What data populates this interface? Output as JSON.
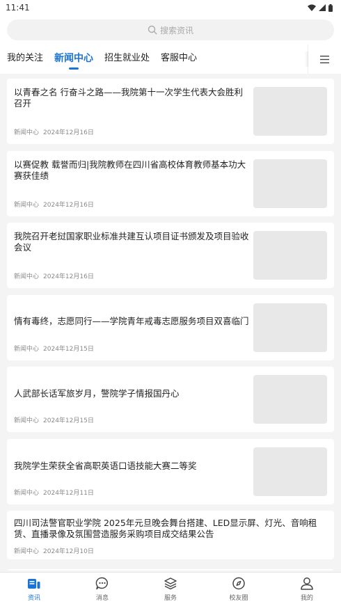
{
  "status": {
    "time": "11:41"
  },
  "search": {
    "placeholder": "搜索资讯"
  },
  "tabs": [
    {
      "label": "我的关注"
    },
    {
      "label": "新闻中心",
      "active": true
    },
    {
      "label": "招生就业处"
    },
    {
      "label": "客服中心"
    }
  ],
  "articles": [
    {
      "title": "以青春之名  行奋斗之路——我院第十一次学生代表大会胜利召开",
      "source": "新闻中心",
      "date": "2024年12月16日",
      "has_thumb": true
    },
    {
      "title": "以赛促教 载誉而归|我院教师在四川省高校体育教师基本功大赛获佳绩",
      "source": "新闻中心",
      "date": "2024年12月16日",
      "has_thumb": true
    },
    {
      "title": "我院召开老挝国家职业标准共建互认项目证书颁发及项目验收会议",
      "source": "新闻中心",
      "date": "2024年12月16日",
      "has_thumb": true
    },
    {
      "title": "情有毒终，志愿同行——学院青年戒毒志愿服务项目双喜临门",
      "source": "新闻中心",
      "date": "2024年12月15日",
      "has_thumb": true
    },
    {
      "title": "人武部长话军旅岁月，警院学子情报国丹心",
      "source": "新闻中心",
      "date": "2024年12月15日",
      "has_thumb": true
    },
    {
      "title": "我院学生荣获全省高职英语口语技能大赛二等奖",
      "source": "新闻中心",
      "date": "2024年12月11日",
      "has_thumb": true
    },
    {
      "title": "四川司法警官职业学院 2025年元旦晚会舞台搭建、LED显示屏、灯光、音响租赁、直播录像及氛围营造服务采购项目成交结果公告",
      "source": "新闻中心",
      "date": "2024年12月10日",
      "has_thumb": false
    }
  ],
  "bottom_nav": [
    {
      "label": "资讯",
      "icon": "news-icon",
      "active": true
    },
    {
      "label": "消息",
      "icon": "message-icon"
    },
    {
      "label": "服务",
      "icon": "layers-icon"
    },
    {
      "label": "校友圈",
      "icon": "compass-icon"
    },
    {
      "label": "我的",
      "icon": "user-icon"
    }
  ],
  "colors": {
    "accent": "#1a73d6",
    "background": "#f4f4f4",
    "thumb_placeholder": "#e8e8e8"
  }
}
